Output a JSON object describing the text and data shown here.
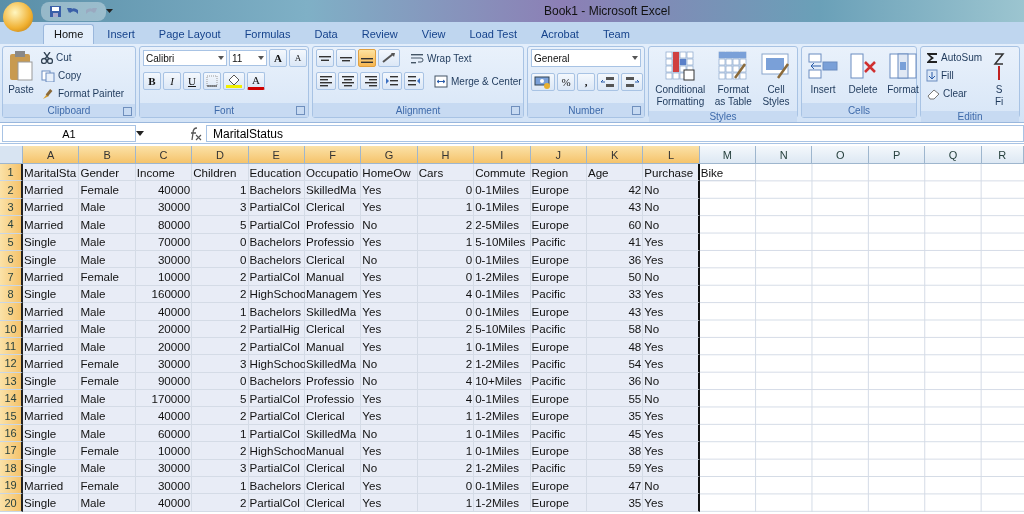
{
  "window": {
    "title": "Book1 - Microsoft Excel"
  },
  "tabs": [
    {
      "label": "Home",
      "selected": true
    },
    {
      "label": "Insert",
      "selected": false
    },
    {
      "label": "Page Layout",
      "selected": false
    },
    {
      "label": "Formulas",
      "selected": false
    },
    {
      "label": "Data",
      "selected": false
    },
    {
      "label": "Review",
      "selected": false
    },
    {
      "label": "View",
      "selected": false
    },
    {
      "label": "Load Test",
      "selected": false
    },
    {
      "label": "Acrobat",
      "selected": false
    },
    {
      "label": "Team",
      "selected": false
    }
  ],
  "ribbon": {
    "clipboard": {
      "label": "Clipboard",
      "paste": "Paste",
      "cut": "Cut",
      "copy": "Copy",
      "format_painter": "Format Painter"
    },
    "font": {
      "label": "Font",
      "font_name": "Calibri",
      "font_size": "11",
      "grow": "A",
      "shrink": "A",
      "bold": "B",
      "italic": "I",
      "underline": "U",
      "font_color": "A"
    },
    "alignment": {
      "label": "Alignment",
      "wrap_text": "Wrap Text",
      "merge_center": "Merge & Center",
      "bottom_align_selected": true
    },
    "number": {
      "label": "Number",
      "format": "General",
      "percent": "%",
      "comma": ","
    },
    "styles": {
      "label": "Styles",
      "buttons": [
        {
          "label": "Conditional Formatting",
          "kind": "conditional"
        },
        {
          "label": "Format as Table",
          "kind": "table"
        },
        {
          "label": "Cell Styles",
          "kind": "styles"
        }
      ]
    },
    "cells": {
      "label": "Cells",
      "buttons": [
        {
          "label": "Insert",
          "kind": "insert"
        },
        {
          "label": "Delete",
          "kind": "delete"
        },
        {
          "label": "Format",
          "kind": "format"
        }
      ]
    },
    "editing": {
      "label": "Editin",
      "autosum": "AutoSum",
      "fill": "Fill",
      "clear": "Clear",
      "cut_lines": [
        "S",
        "Fi"
      ]
    }
  },
  "formula_bar": {
    "name_box": "A1",
    "formula": "MaritalStatus"
  },
  "columns": [
    {
      "label": "A",
      "selected": true,
      "kind": "text"
    },
    {
      "label": "B",
      "selected": true,
      "kind": "text"
    },
    {
      "label": "C",
      "selected": true,
      "kind": "number"
    },
    {
      "label": "D",
      "selected": true,
      "kind": "number"
    },
    {
      "label": "E",
      "selected": true,
      "kind": "text"
    },
    {
      "label": "F",
      "selected": true,
      "kind": "text"
    },
    {
      "label": "G",
      "selected": true,
      "kind": "text"
    },
    {
      "label": "H",
      "selected": true,
      "kind": "number"
    },
    {
      "label": "I",
      "selected": true,
      "kind": "text"
    },
    {
      "label": "J",
      "selected": true,
      "kind": "text"
    },
    {
      "label": "K",
      "selected": true,
      "kind": "number"
    },
    {
      "label": "L",
      "selected": true,
      "kind": "text"
    },
    {
      "label": "M",
      "selected": false
    },
    {
      "label": "N",
      "selected": false
    },
    {
      "label": "O",
      "selected": false
    },
    {
      "label": "P",
      "selected": false
    },
    {
      "label": "Q",
      "selected": false
    },
    {
      "label": "R",
      "selected": false
    }
  ],
  "rows": [
    {
      "number": "1",
      "selected": true,
      "cells": [
        "MaritalSta",
        "Gender",
        "Income",
        "Children",
        "Education",
        "Occupatio",
        "HomeOw",
        "Cars",
        "Commute",
        "Region",
        "Age",
        "Purchase",
        "Bike"
      ]
    },
    {
      "number": "2",
      "selected": true,
      "cells": [
        "Married",
        "Female",
        "40000",
        "1",
        "Bachelors",
        "SkilledMa",
        "Yes",
        "0",
        "0-1Miles",
        "Europe",
        "42",
        "No"
      ]
    },
    {
      "number": "3",
      "selected": true,
      "cells": [
        "Married",
        "Male",
        "30000",
        "3",
        "PartialCol",
        "Clerical",
        "Yes",
        "1",
        "0-1Miles",
        "Europe",
        "43",
        "No"
      ]
    },
    {
      "number": "4",
      "selected": true,
      "cells": [
        "Married",
        "Male",
        "80000",
        "5",
        "PartialCol",
        "Professio",
        "No",
        "2",
        "2-5Miles",
        "Europe",
        "60",
        "No"
      ]
    },
    {
      "number": "5",
      "selected": true,
      "cells": [
        "Single",
        "Male",
        "70000",
        "0",
        "Bachelors",
        "Professio",
        "Yes",
        "1",
        "5-10Miles",
        "Pacific",
        "41",
        "Yes"
      ]
    },
    {
      "number": "6",
      "selected": true,
      "cells": [
        "Single",
        "Male",
        "30000",
        "0",
        "Bachelors",
        "Clerical",
        "No",
        "0",
        "0-1Miles",
        "Europe",
        "36",
        "Yes"
      ]
    },
    {
      "number": "7",
      "selected": true,
      "cells": [
        "Married",
        "Female",
        "10000",
        "2",
        "PartialCol",
        "Manual",
        "Yes",
        "0",
        "1-2Miles",
        "Europe",
        "50",
        "No"
      ]
    },
    {
      "number": "8",
      "selected": true,
      "cells": [
        "Single",
        "Male",
        "160000",
        "2",
        "HighSchoo",
        "Managem",
        "Yes",
        "4",
        "0-1Miles",
        "Pacific",
        "33",
        "Yes"
      ]
    },
    {
      "number": "9",
      "selected": true,
      "cells": [
        "Married",
        "Male",
        "40000",
        "1",
        "Bachelors",
        "SkilledMa",
        "Yes",
        "0",
        "0-1Miles",
        "Europe",
        "43",
        "Yes"
      ]
    },
    {
      "number": "10",
      "selected": true,
      "cells": [
        "Married",
        "Male",
        "20000",
        "2",
        "PartialHig",
        "Clerical",
        "Yes",
        "2",
        "5-10Miles",
        "Pacific",
        "58",
        "No"
      ]
    },
    {
      "number": "11",
      "selected": true,
      "cells": [
        "Married",
        "Male",
        "20000",
        "2",
        "PartialCol",
        "Manual",
        "Yes",
        "1",
        "0-1Miles",
        "Europe",
        "48",
        "Yes"
      ]
    },
    {
      "number": "12",
      "selected": true,
      "cells": [
        "Married",
        "Female",
        "30000",
        "3",
        "HighSchoo",
        "SkilledMa",
        "No",
        "2",
        "1-2Miles",
        "Pacific",
        "54",
        "Yes"
      ]
    },
    {
      "number": "13",
      "selected": true,
      "cells": [
        "Single",
        "Female",
        "90000",
        "0",
        "Bachelors",
        "Professio",
        "No",
        "4",
        "10+Miles",
        "Pacific",
        "36",
        "No"
      ]
    },
    {
      "number": "14",
      "selected": true,
      "cells": [
        "Married",
        "Male",
        "170000",
        "5",
        "PartialCol",
        "Professio",
        "Yes",
        "4",
        "0-1Miles",
        "Europe",
        "55",
        "No"
      ]
    },
    {
      "number": "15",
      "selected": true,
      "cells": [
        "Married",
        "Male",
        "40000",
        "2",
        "PartialCol",
        "Clerical",
        "Yes",
        "1",
        "1-2Miles",
        "Europe",
        "35",
        "Yes"
      ]
    },
    {
      "number": "16",
      "selected": true,
      "cells": [
        "Single",
        "Male",
        "60000",
        "1",
        "PartialCol",
        "SkilledMa",
        "No",
        "1",
        "0-1Miles",
        "Pacific",
        "45",
        "Yes"
      ]
    },
    {
      "number": "17",
      "selected": true,
      "cells": [
        "Single",
        "Female",
        "10000",
        "2",
        "HighSchoo",
        "Manual",
        "Yes",
        "1",
        "0-1Miles",
        "Europe",
        "38",
        "Yes"
      ]
    },
    {
      "number": "18",
      "selected": true,
      "cells": [
        "Single",
        "Male",
        "30000",
        "3",
        "PartialCol",
        "Clerical",
        "No",
        "2",
        "1-2Miles",
        "Pacific",
        "59",
        "Yes"
      ]
    },
    {
      "number": "19",
      "selected": true,
      "cells": [
        "Married",
        "Female",
        "30000",
        "1",
        "Bachelors",
        "Clerical",
        "Yes",
        "0",
        "0-1Miles",
        "Europe",
        "47",
        "No"
      ]
    },
    {
      "number": "20",
      "selected": true,
      "cells": [
        "Single",
        "Male",
        "40000",
        "2",
        "PartialCol",
        "Clerical",
        "Yes",
        "1",
        "1-2Miles",
        "Europe",
        "35",
        "Yes"
      ]
    }
  ]
}
